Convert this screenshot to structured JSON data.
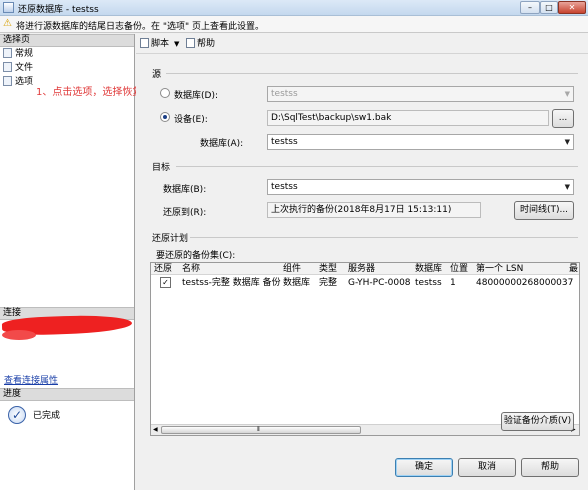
{
  "window": {
    "title": "还原数据库 - testss",
    "min": "–",
    "max": "□",
    "close": "✕"
  },
  "warning": {
    "text": "将进行源数据库的结尾日志备份。在 \"选项\" 页上查看此设置。"
  },
  "sidebar": {
    "pages_header": "选择页",
    "pages": [
      {
        "label": "常规"
      },
      {
        "label": "文件"
      },
      {
        "label": "选项"
      }
    ],
    "annotation": "1、点击选项，选择恢复模式",
    "connection_header": "连接",
    "connection_link": "查看连接属性",
    "progress_header": "进度",
    "progress_status": "已完成"
  },
  "toolbar": {
    "script_label": "脚本",
    "script_caret": "▼",
    "help_label": "帮助"
  },
  "source": {
    "label": "源",
    "database_radio": "数据库(D):",
    "database_value": "testss",
    "device_radio": "设备(E):",
    "device_value": "D:\\SqlTest\\backup\\sw1.bak",
    "browse_label": "...",
    "database_label": "数据库(A):",
    "database_combo": "testss"
  },
  "destination": {
    "label": "目标",
    "database_label": "数据库(B):",
    "database_value": "testss",
    "restore_to_label": "还原到(R):",
    "restore_to_value": "上次执行的备份(2018年8月17日 15:13:11)",
    "timeline_label": "时间线(T)..."
  },
  "plan": {
    "label": "还原计划",
    "backupsets_label": "要还原的备份集(C):",
    "columns": [
      "还原",
      "名称",
      "组件",
      "类型",
      "服务器",
      "数据库",
      "位置",
      "第一个 LSN",
      "最"
    ],
    "rows": [
      {
        "checked": "✓",
        "name": "testss-完整 数据库 备份",
        "component": "数据库",
        "type": "完整",
        "server": "G-YH-PC-0008",
        "database": "testss",
        "position": "1",
        "lsn": "48000000268000037"
      }
    ],
    "scroll_left": "◀",
    "scroll_right": "▶",
    "scroll_grip": "⦀",
    "verify_label": "验证备份介质(V)"
  },
  "footer": {
    "ok_label": "确定",
    "cancel_label": "取消",
    "help_label": "帮助"
  },
  "icons": {
    "warning": "⚠",
    "combo_arrow": "▼",
    "progress": "✓"
  },
  "colors": {
    "annotation": "#e03a3a",
    "link": "#1a3fa8",
    "redaction": "#ee2121"
  }
}
